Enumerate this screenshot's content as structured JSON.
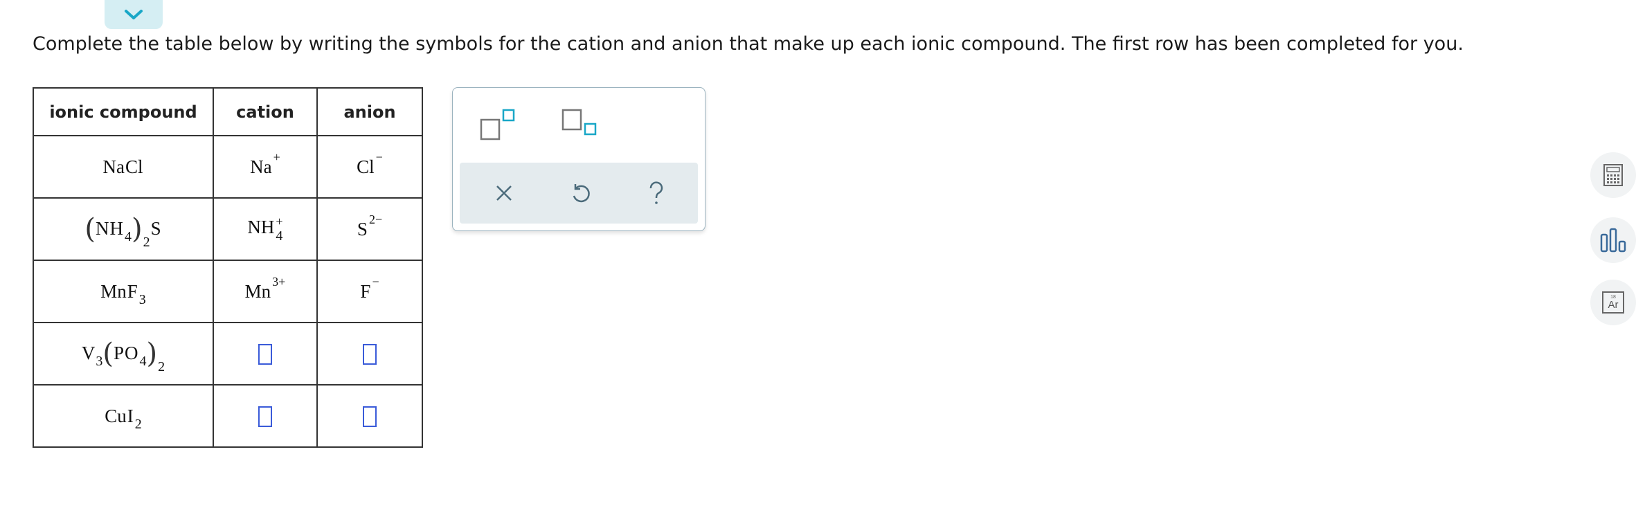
{
  "collapse_tab": {
    "icon": "chevron-down-icon",
    "color": "#19a7c7"
  },
  "instructions": "Complete the table below by writing the symbols for the cation and anion that make up each ionic compound. The first row has been completed for you.",
  "table": {
    "headers": [
      "ionic compound",
      "cation",
      "anion"
    ],
    "rows": [
      {
        "compound": {
          "a": "Na",
          "b": "Cl"
        },
        "cation": {
          "symbol": "Na",
          "charge": "+"
        },
        "anion": {
          "symbol": "Cl",
          "charge": "−"
        }
      },
      {
        "compound": {
          "group": [
            "N",
            "H"
          ],
          "group_sub": "4",
          "outer_sub": "2",
          "tail": "S"
        },
        "cation": {
          "symbol": "NH",
          "sub": "4",
          "charge": "+"
        },
        "anion": {
          "symbol": "S",
          "charge": "2−"
        }
      },
      {
        "compound": {
          "a": "Mn",
          "b": "F",
          "b_sub": "3"
        },
        "cation": {
          "symbol": "Mn",
          "charge": "3+"
        },
        "anion": {
          "symbol": "F",
          "charge": "−"
        }
      },
      {
        "compound": {
          "a": "V",
          "a_sub": "3",
          "group": [
            "P",
            "O"
          ],
          "group_sub": "4",
          "outer_sub": "2"
        },
        "cation": {
          "answer": ""
        },
        "anion": {
          "answer": ""
        }
      },
      {
        "compound": {
          "a": "Cu",
          "b": "I",
          "b_sub": "2"
        },
        "cation": {
          "answer": ""
        },
        "anion": {
          "answer": ""
        }
      }
    ]
  },
  "palette": {
    "buttons": [
      "superscript-icon",
      "subscript-icon"
    ],
    "tools": [
      "clear-icon",
      "undo-icon",
      "help-icon"
    ],
    "tool_bg": "#e4ebee",
    "accent": "#19a7c7"
  },
  "side_toolbar": [
    "calculator-icon",
    "chart-icon",
    "periodic-table-icon"
  ],
  "side_labels": {
    "periodic_number": "18",
    "periodic_symbol": "Ar"
  }
}
